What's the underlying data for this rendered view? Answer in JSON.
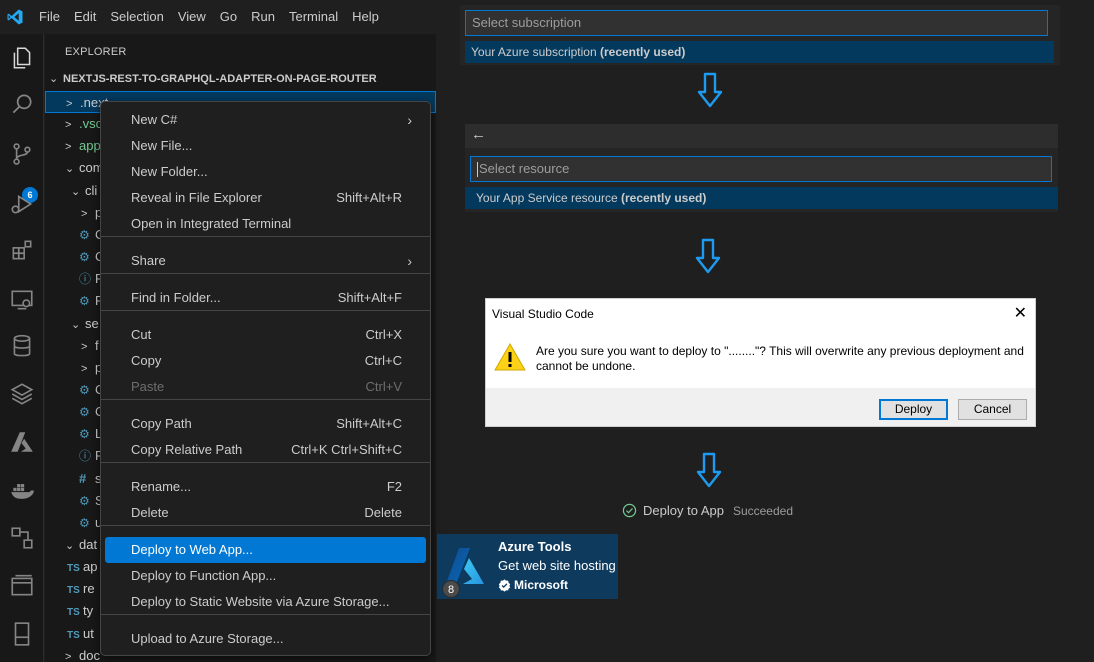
{
  "menubar": {
    "items": [
      "File",
      "Edit",
      "Selection",
      "View",
      "Go",
      "Run",
      "Terminal",
      "Help"
    ]
  },
  "activity_bar": {
    "icons": [
      "explorer-icon",
      "search-icon",
      "source-control-icon",
      "run-debug-icon",
      "extensions-icon",
      "remote-explorer-icon",
      "database-icon",
      "layers-icon",
      "azure-icon",
      "docker-icon",
      "graph-icon",
      "panels-icon",
      "device-icon"
    ],
    "scm_badge": "6"
  },
  "explorer": {
    "title": "EXPLORER",
    "project": "NEXTJS-REST-TO-GRAPHQL-ADAPTER-ON-PAGE-ROUTER",
    "rows": [
      {
        "twisty": ">",
        "icon": "",
        "label": ".next",
        "color": "#cccccc"
      },
      {
        "twisty": ">",
        "icon": "",
        "label": ".vsc",
        "color": "#73c991"
      },
      {
        "twisty": ">",
        "icon": "",
        "label": "app",
        "color": "#73c991"
      },
      {
        "twisty": "⌄",
        "icon": "",
        "label": "com",
        "color": "#cccccc"
      },
      {
        "twisty": "⌄",
        "icon": "",
        "label": "cli",
        "color": "#cccccc"
      },
      {
        "twisty": ">",
        "icon": "",
        "label": "p",
        "color": "#cccccc"
      },
      {
        "twisty": "",
        "icon": "⚙",
        "label": "C",
        "color": "#cccccc"
      },
      {
        "twisty": "",
        "icon": "⚙",
        "label": "C",
        "color": "#cccccc"
      },
      {
        "twisty": "",
        "icon": "ⓘ",
        "label": "R",
        "color": "#cccccc"
      },
      {
        "twisty": "",
        "icon": "⚙",
        "label": "R",
        "color": "#cccccc"
      },
      {
        "twisty": "⌄",
        "icon": "",
        "label": "se",
        "color": "#cccccc"
      },
      {
        "twisty": ">",
        "icon": "",
        "label": "f",
        "color": "#cccccc"
      },
      {
        "twisty": ">",
        "icon": "",
        "label": "p",
        "color": "#cccccc"
      },
      {
        "twisty": "",
        "icon": "⚙",
        "label": "C",
        "color": "#cccccc"
      },
      {
        "twisty": "",
        "icon": "⚙",
        "label": "C",
        "color": "#cccccc"
      },
      {
        "twisty": "",
        "icon": "⚙",
        "label": "L",
        "color": "#cccccc"
      },
      {
        "twisty": "",
        "icon": "ⓘ",
        "label": "R",
        "color": "#cccccc"
      },
      {
        "twisty": "",
        "icon": "#",
        "label": "s",
        "color": "#cccccc"
      },
      {
        "twisty": "",
        "icon": "⚙",
        "label": "S",
        "color": "#cccccc"
      },
      {
        "twisty": "",
        "icon": "⚙",
        "label": "u",
        "color": "#cccccc"
      },
      {
        "twisty": "⌄",
        "icon": "",
        "label": "dat",
        "color": "#cccccc"
      },
      {
        "twisty": "",
        "icon": "TS",
        "label": "ap",
        "color": "#cccccc"
      },
      {
        "twisty": "",
        "icon": "TS",
        "label": "re",
        "color": "#cccccc"
      },
      {
        "twisty": "",
        "icon": "TS",
        "label": "ty",
        "color": "#cccccc"
      },
      {
        "twisty": "",
        "icon": "TS",
        "label": "ut",
        "color": "#cccccc"
      },
      {
        "twisty": ">",
        "icon": "",
        "label": "doc",
        "color": "#cccccc"
      }
    ]
  },
  "context_menu": {
    "items": [
      {
        "label": "New C#",
        "shortcut": "",
        "submenu": true
      },
      {
        "label": "New File...",
        "shortcut": ""
      },
      {
        "label": "New Folder...",
        "shortcut": ""
      },
      {
        "label": "Reveal in File Explorer",
        "shortcut": "Shift+Alt+R"
      },
      {
        "label": "Open in Integrated Terminal",
        "shortcut": ""
      },
      {
        "label": "Share",
        "shortcut": "",
        "submenu": true
      },
      {
        "label": "Find in Folder...",
        "shortcut": "Shift+Alt+F"
      },
      {
        "label": "Cut",
        "shortcut": "Ctrl+X"
      },
      {
        "label": "Copy",
        "shortcut": "Ctrl+C"
      },
      {
        "label": "Paste",
        "shortcut": "Ctrl+V",
        "disabled": true
      },
      {
        "label": "Copy Path",
        "shortcut": "Shift+Alt+C"
      },
      {
        "label": "Copy Relative Path",
        "shortcut": "Ctrl+K Ctrl+Shift+C"
      },
      {
        "label": "Rename...",
        "shortcut": "F2"
      },
      {
        "label": "Delete",
        "shortcut": "Delete"
      },
      {
        "label": "Deploy to Web App...",
        "shortcut": "",
        "active": true
      },
      {
        "label": "Deploy to Function App...",
        "shortcut": ""
      },
      {
        "label": "Deploy to Static Website via Azure Storage...",
        "shortcut": ""
      },
      {
        "label": "Upload to Azure Storage...",
        "shortcut": ""
      }
    ]
  },
  "azure_tools": {
    "name": "Azure Tools",
    "description": "Get web site hosting",
    "publisher": "Microsoft",
    "badge": "8"
  },
  "subscription_pick": {
    "placeholder": "Select subscription",
    "item_label": "Your Azure subscription",
    "item_tag": "(recently used)"
  },
  "resource_pick": {
    "back_icon": "←",
    "placeholder": "Select resource",
    "item_label": "Your App Service resource",
    "item_tag": "(recently used)"
  },
  "dialog": {
    "title": "Visual Studio Code",
    "close": "✕",
    "message": "Are you sure you want to deploy to \"........\"? This will overwrite any previous deployment and cannot be undone.",
    "deploy_label": "Deploy",
    "cancel_label": "Cancel"
  },
  "status": {
    "action": "Deploy to App",
    "result": "Succeeded"
  },
  "colors": {
    "accent": "#0078d4",
    "flow_arrow": "#1e9bf0",
    "success": "#73c991"
  }
}
